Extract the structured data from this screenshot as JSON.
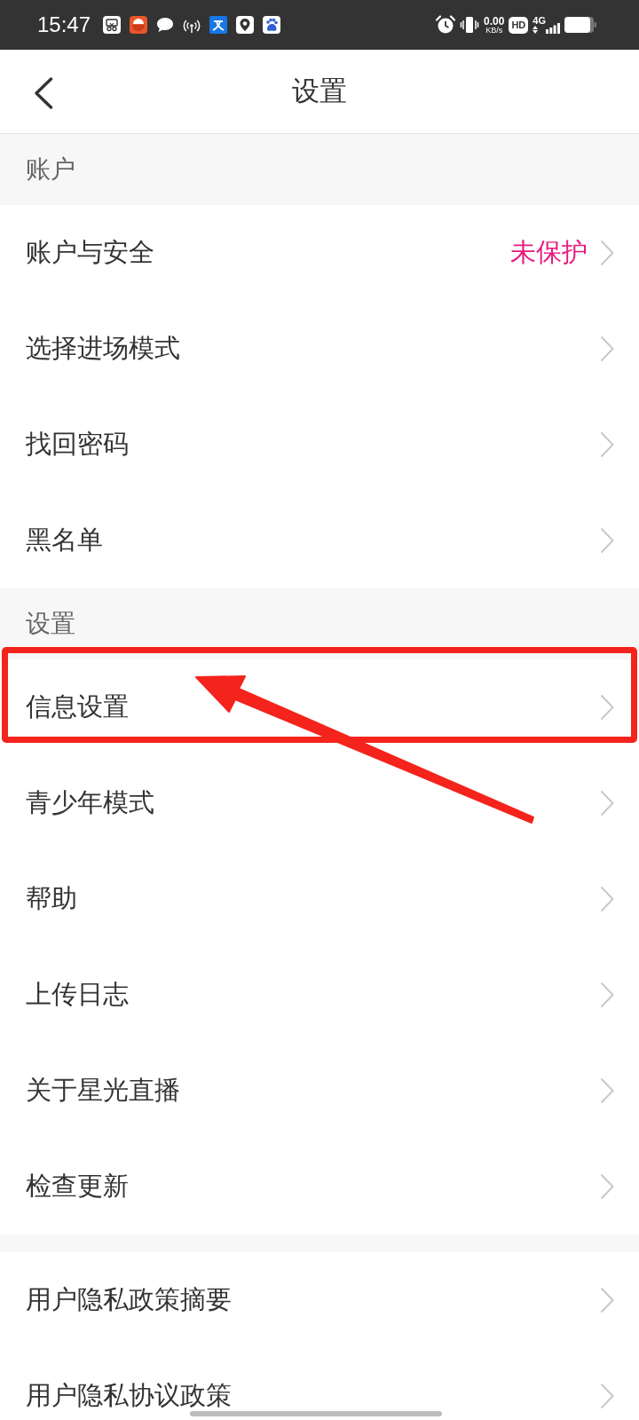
{
  "status_bar": {
    "time": "15:47",
    "speed": "0.00",
    "speed_unit": "KB/s",
    "hd": "HD",
    "network": "4G"
  },
  "header": {
    "title": "设置"
  },
  "sections": [
    {
      "title": "账户",
      "items": [
        {
          "label": "账户与安全",
          "value": "未保护",
          "highlighted": false
        },
        {
          "label": "选择进场模式",
          "highlighted": false
        },
        {
          "label": "找回密码",
          "highlighted": false
        },
        {
          "label": "黑名单",
          "highlighted": false
        }
      ]
    },
    {
      "title": "设置",
      "items": [
        {
          "label": "信息设置",
          "highlighted": true
        },
        {
          "label": "青少年模式",
          "highlighted": false
        },
        {
          "label": "帮助",
          "highlighted": false
        },
        {
          "label": "上传日志",
          "highlighted": false
        },
        {
          "label": "关于星光直播",
          "highlighted": false
        },
        {
          "label": "检查更新",
          "highlighted": false
        }
      ]
    },
    {
      "items": [
        {
          "label": "用户隐私政策摘要",
          "highlighted": false
        },
        {
          "label": "用户隐私协议政策",
          "highlighted": false
        }
      ]
    }
  ]
}
